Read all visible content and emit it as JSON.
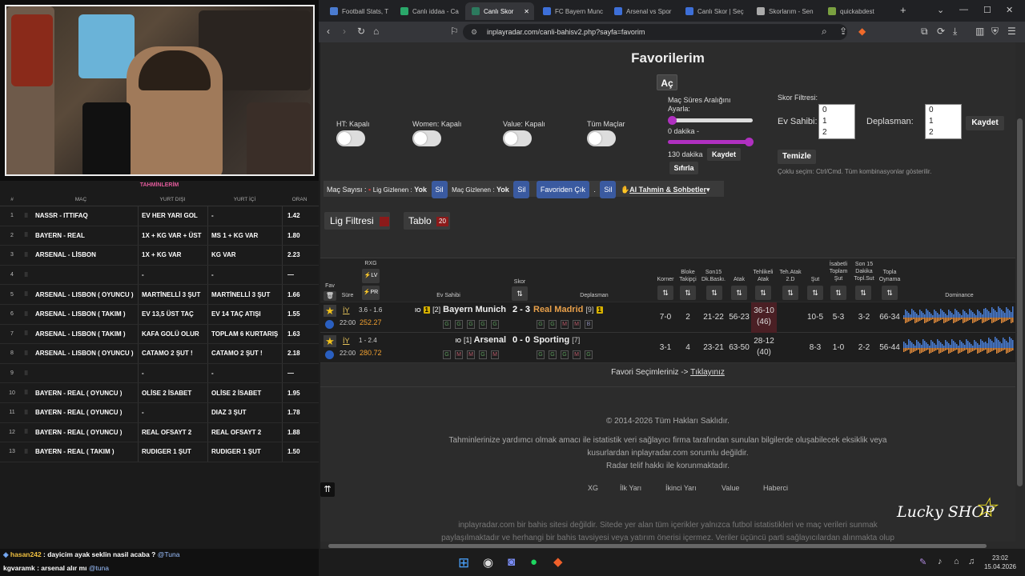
{
  "stream": {
    "table_title": "TAHMİNLERİM",
    "columns": [
      "#",
      "MAÇ",
      "YURT DIŞI",
      "YURT İÇİ",
      "ORAN"
    ],
    "rows": [
      {
        "n": "1",
        "mac": "NASSR - ITTIFAQ",
        "yd": "EV HER YARI GOL",
        "yi": "-",
        "oran": "1.42"
      },
      {
        "n": "2",
        "mac": "BAYERN - REAL",
        "yd": "1X + KG VAR + ÜST",
        "yi": "MS 1 + KG VAR",
        "oran": "1.80"
      },
      {
        "n": "3",
        "mac": "ARSENAL - LİSBON",
        "yd": "1X + KG VAR",
        "yi": "KG VAR",
        "oran": "2.23"
      },
      {
        "n": "4",
        "mac": "",
        "yd": "-",
        "yi": "-",
        "oran": "—"
      },
      {
        "n": "5",
        "mac": "ARSENAL - LISBON ( OYUNCU )",
        "yd": "MARTİNELLİ 3 ŞUT",
        "yi": "MARTİNELLİ 3 ŞUT",
        "oran": "1.66"
      },
      {
        "n": "6",
        "mac": "ARSENAL - LISBON ( TAKIM )",
        "yd": "EV 13,5 ÜST TAÇ",
        "yi": "EV 14 TAÇ ATIŞI",
        "oran": "1.55"
      },
      {
        "n": "7",
        "mac": "ARSENAL - LISBON ( TAKIM )",
        "yd": "KAFA GOLÜ OLUR",
        "yi": "TOPLAM 6 KURTARIŞ",
        "oran": "1.63"
      },
      {
        "n": "8",
        "mac": "ARSENAL - LISBON ( OYUNCU )",
        "yd": "CATAMO 2 ŞUT !",
        "yi": "CATAMO 2 ŞUT !",
        "oran": "2.18"
      },
      {
        "n": "9",
        "mac": "",
        "yd": "-",
        "yi": "-",
        "oran": "—"
      },
      {
        "n": "10",
        "mac": "BAYERN - REAL ( OYUNCU )",
        "yd": "OLİSE 2 İSABET",
        "yi": "OLİSE 2 İSABET",
        "oran": "1.95"
      },
      {
        "n": "11",
        "mac": "BAYERN - REAL ( OYUNCU )",
        "yd": "-",
        "yi": "DIAZ 3 ŞUT",
        "oran": "1.78"
      },
      {
        "n": "12",
        "mac": "BAYERN - REAL ( OYUNCU )",
        "yd": "REAL OFSAYT 2",
        "yi": "REAL OFSAYT 2",
        "oran": "1.88"
      },
      {
        "n": "13",
        "mac": "BAYERN - REAL ( TAKIM )",
        "yd": "RUDIGER 1 ŞUT",
        "yi": "RUDIGER 1 ŞUT",
        "oran": "1.50"
      }
    ],
    "chat": [
      {
        "user": "hasan242",
        "text": ": dayicim ayak seklin nasil acaba ?",
        "mention": "@Tuna"
      },
      {
        "user": "kgvaramk",
        "text": ": arsenal alır mı",
        "mention": "@tuna"
      }
    ]
  },
  "browser": {
    "tabs": [
      {
        "label": "Football Stats, T",
        "color": "#4a7bd0"
      },
      {
        "label": "Canlı iddaa - Ca",
        "color": "#2aa86a"
      },
      {
        "label": "Canlı Skor",
        "color": "#2c7a5e",
        "active": true
      },
      {
        "label": "FC Bayern Munc",
        "color": "#3d6fd8"
      },
      {
        "label": "Arsenal vs Spor",
        "color": "#3d6fd8"
      },
      {
        "label": "Canlı Skor | Seç",
        "color": "#3d6fd8"
      },
      {
        "label": "Skorlarım - Sen",
        "color": "#aaaaaa"
      },
      {
        "label": "quickabdest",
        "color": "#7aa040"
      }
    ],
    "url": "inplayradar.com/canli-bahisv2.php?sayfa=favorim"
  },
  "page": {
    "title": "Favorilerim",
    "ac_button": "Aç",
    "toggles": [
      {
        "label": "HT: Kapalı"
      },
      {
        "label": "Women: Kapalı"
      },
      {
        "label": "Value: Kapalı"
      },
      {
        "label": "Tüm Maçlar"
      }
    ],
    "range": {
      "title": "Maç Süres Aralığını Ayarla:",
      "min_label": "0 dakika -",
      "max_label": "130 dakika",
      "save": "Kaydet",
      "reset": "Sıfırla"
    },
    "score_filter": {
      "title": "Skor Filtresi:",
      "home_label": "Ev Sahibi:",
      "away_label": "Deplasman:",
      "options": [
        "0",
        "1",
        "2"
      ],
      "save": "Kaydet",
      "clear": "Temizle",
      "hint": "Çoklu seçim: Ctrl/Cmd. Tüm kombinasyonlar gösterilir."
    },
    "optbar": {
      "mac_sayisi": "Maç Sayısı :",
      "lig_gizlenen": "Lig Gizlenen :",
      "yok1": "Yok",
      "sil": "Sil",
      "mac_gizlenen": "Maç Gizlenen :",
      "yok2": "Yok",
      "favoriden_cik": "Favoriden Çık",
      "ai": "AI Tahmin & Sohbetler"
    },
    "lig_filtresi": "Lig Filtresi",
    "tablo": "Tablo",
    "tablo_count": "20",
    "headers": {
      "fav": "Fav",
      "sure": "Süre",
      "rxg": "RXG",
      "lv": "LV",
      "pr": "PR",
      "ev": "Ev Sahibi",
      "skor": "Skor",
      "dep": "Deplasman",
      "korner": "Korner",
      "bloke": "Bloke Takipçi",
      "son15": "Son15 Dk.Baskı.",
      "atak": "Atak",
      "tehlikeli": "Tehlikeli Atak",
      "teh2d": "Teh.Atak 2.D",
      "sut": "Şut",
      "isabetli": "İsabetli Toplam Şut",
      "son15sut": "Son 15 Dakika Topl.Sut",
      "topla": "Topla Oynama",
      "dominance": "Dominance"
    },
    "matches": [
      {
        "period": "İY",
        "time": "22:00",
        "rxg": "3.6 - 1.6",
        "value": "252.27",
        "io": "IO",
        "home_rank": "[2]",
        "home_badge": "1",
        "home": "Bayern Munich",
        "score": "2 - 3",
        "away": "Real Madrid",
        "away_rank": "[9]",
        "away_badge": "1",
        "home_form": [
          "G",
          "G",
          "G",
          "G",
          "G"
        ],
        "away_form": [
          "G",
          "G",
          "M",
          "M",
          "B"
        ],
        "korner": "7-0",
        "bloke": "2",
        "son15": "21-22",
        "atak": "56-23",
        "teh": "36-10",
        "teh_sub": "(46)",
        "sut": "10-5",
        "isabet": "5-3",
        "son15sut": "3-2",
        "topla": "66-34"
      },
      {
        "period": "İY",
        "time": "22:00",
        "rxg": "1 - 2.4",
        "value": "280.72",
        "io": "IO",
        "home_rank": "[1]",
        "home_badge": "",
        "home": "Arsenal",
        "score": "0 - 0",
        "away": "Sporting",
        "away_rank": "[7]",
        "away_badge": "",
        "home_form": [
          "G",
          "M",
          "M",
          "G",
          "M"
        ],
        "away_form": [
          "G",
          "G",
          "G",
          "M",
          "G"
        ],
        "korner": "3-1",
        "bloke": "4",
        "son15": "23-21",
        "atak": "63-50",
        "teh": "28-12",
        "teh_sub": "(40)",
        "sut": "8-3",
        "isabet": "1-0",
        "son15sut": "2-2",
        "topla": "56-44"
      }
    ],
    "fav_line": "Favori Seçimleriniz ->",
    "fav_link": "Tıklayınız",
    "copyright": "© 2014-2026 Tüm Hakları Saklıdır.",
    "disclaimer1": "Tahminlerinize yardımcı olmak amacı ile istatistik veri sağlayıcı firma tarafından sunulan bilgilerde oluşabilecek eksiklik veya",
    "disclaimer2": "kusurlardan inplayradar.com sorumlu değildir.",
    "disclaimer3": "Radar telif hakkı ile korunmaktadır.",
    "footer_links": [
      "XG",
      "İlk Yarı",
      "İkinci Yarı",
      "Value",
      "Haberci"
    ],
    "bottom_text1": "inplayradar.com bir bahis sitesi değildir. Sitede yer alan tüm içerikler yalnızca futbol istatistikleri ve maç verileri sunmak",
    "bottom_text2": "paylaşılmaktadır ve herhangi bir bahis tavsiyesi veya yatırım önerisi içermez. Veriler üçüncü parti sağlayıcılardan alınmakta olup",
    "logo": "Lucky SHOP"
  },
  "taskbar": {
    "time": "23:02",
    "date": "15.04.2026"
  }
}
